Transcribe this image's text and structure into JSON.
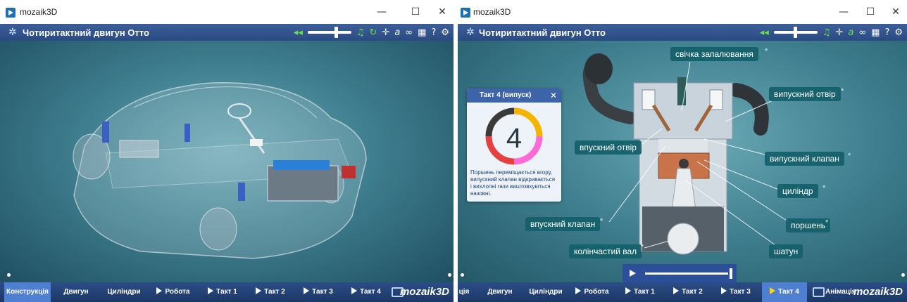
{
  "left": {
    "window_title": "mozaik3D",
    "heading": "Чотиритактний двигун Отто",
    "tabs": [
      "Конструкція",
      "Двигун",
      "Циліндри",
      "Робота",
      "Такт 1",
      "Такт 2",
      "Такт 3",
      "Такт 4"
    ],
    "brand": "mozaik3D"
  },
  "right": {
    "window_title": "mozaik3D",
    "heading": "Чотиритактний двигун Отто",
    "tabs": [
      "ція",
      "Двигун",
      "Циліндри",
      "Робота",
      "Такт 1",
      "Такт 2",
      "Такт 3",
      "Такт 4",
      "Анімація"
    ],
    "brand": "mozaik3D",
    "panel": {
      "title": "Такт 4 (випуск)",
      "number": "4",
      "text": "Поршень переміщається вгору, випускний клапан відкривається і вихлопні гази виштовхуються назовні."
    },
    "labels": {
      "spark_plug": "свічка запалювання",
      "exhaust_port": "випускний отвір",
      "intake_port": "впускний отвір",
      "exhaust_valve": "випускний клапан",
      "cylinder": "циліндр",
      "intake_valve": "впускний клапан",
      "piston": "поршень",
      "crankshaft": "колінчастий вал",
      "connecting_rod": "шатун"
    }
  },
  "window_buttons": {
    "minimize": "—",
    "maximize": "☐",
    "close": "✕"
  },
  "icons": {
    "close_panel": "close-icon",
    "speaker": "speaker-icon",
    "music": "music-icon",
    "rotate": "rotate-icon",
    "move": "move-icon",
    "font": "text-icon",
    "link": "link-icon",
    "grid": "grid-icon",
    "help": "help-icon",
    "settings": "gear-icon"
  },
  "colors": {
    "accent": "#2a4a82",
    "stage": "#3f7f8f",
    "tab_active": "#4f7fd0",
    "label_bg": "#145f69"
  }
}
